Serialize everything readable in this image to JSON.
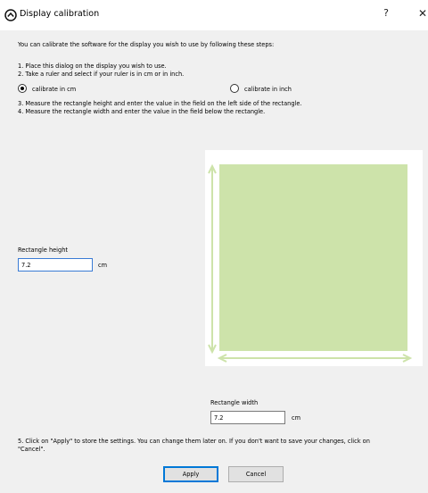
{
  "window": {
    "title": "Display calibration",
    "help_glyph": "?",
    "close_glyph": "✕",
    "icon": "display-calibration-icon"
  },
  "intro": "You can calibrate the software for the display you wish to use by following these steps:",
  "steps": {
    "step1": "1. Place this dialog on the display you wish to use.",
    "step2": "2. Take a ruler and select if your ruler is in cm or in inch.",
    "step3": "3. Measure the rectangle height and enter the value in the field on the left side of the rectangle.",
    "step4": "4. Measure the rectangle width and enter the value in the field below the rectangle.",
    "step5_line1": "5. Click on \"Apply\" to store the settings. You can change them later on. If you don't want to save your changes, click on",
    "step5_line2": "\"Cancel\"."
  },
  "units": {
    "cm_option": "calibrate in cm",
    "inch_option": "calibrate in inch",
    "selected": "cm"
  },
  "height_field": {
    "label": "Rectangle height",
    "value": "7.2",
    "unit": "cm"
  },
  "width_field": {
    "label": "Rectangle width",
    "value": "7.2",
    "unit": "cm"
  },
  "buttons": {
    "apply": "Apply",
    "cancel": "Cancel"
  },
  "colors": {
    "rectangle": "#cde3aa",
    "arrows": "#cde3aa",
    "focus_border": "#3a7bd5"
  }
}
